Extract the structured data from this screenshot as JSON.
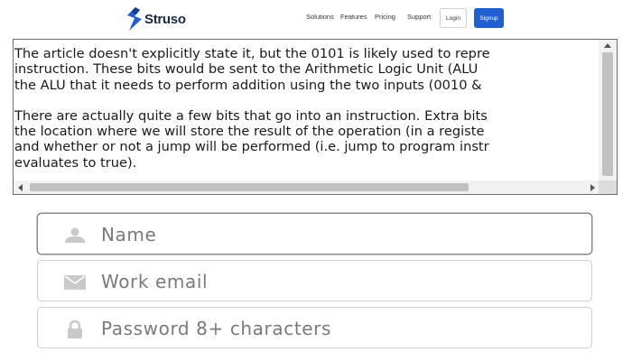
{
  "header": {
    "logo_text": "Struso",
    "nav": [
      "Solutions",
      "Features",
      "Pricing",
      "Support"
    ],
    "login_label": "Login",
    "signup_label": "Signup",
    "brand_color": "#1f5fd1"
  },
  "article": {
    "paragraphs": [
      [
        "The article doesn't explicitly state it, but the 0101 is likely used to repre",
        "instruction. These bits would be sent to the Arithmetic Logic Unit (ALU",
        "the ALU that it needs to perform addition using the two inputs (0010 &"
      ],
      [
        "There are actually quite a few bits that go into an instruction. Extra bits",
        "the location where we will store the result of the operation (in a registe",
        "and whether or not a jump will be performed (i.e. jump to program instr",
        "evaluates to true)."
      ]
    ]
  },
  "form": {
    "name_placeholder": "Name",
    "email_placeholder": "Work email",
    "password_placeholder": "Password 8+ characters",
    "icons": [
      "user-icon",
      "envelope-icon",
      "lock-icon"
    ]
  }
}
